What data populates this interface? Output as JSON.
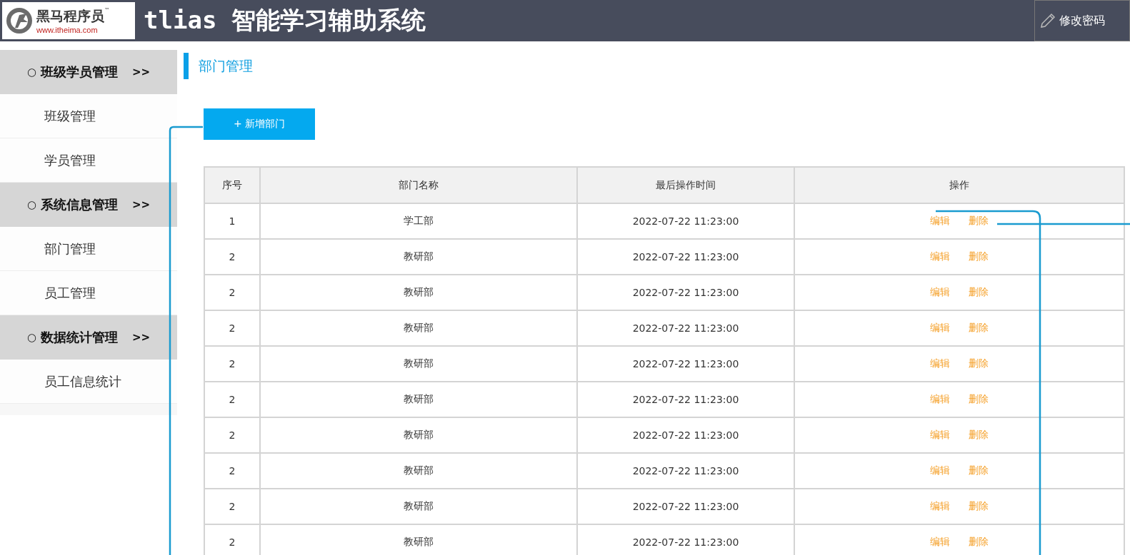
{
  "header": {
    "logo": {
      "brand": "黑马程序员",
      "tm": "™",
      "url": "www.itheima.com"
    },
    "title": "tlias 智能学习辅助系统",
    "action": "修改密码"
  },
  "sidebar": {
    "groups": [
      {
        "marker": "○",
        "label": "班级学员管理",
        "arrow": ">>",
        "children": [
          {
            "label": "班级管理"
          },
          {
            "label": "学员管理"
          }
        ]
      },
      {
        "marker": "○",
        "label": "系统信息管理",
        "arrow": ">>",
        "children": [
          {
            "label": "部门管理"
          },
          {
            "label": "员工管理"
          }
        ]
      },
      {
        "marker": "○",
        "label": "数据统计管理",
        "arrow": ">>",
        "children": [
          {
            "label": "员工信息统计"
          }
        ]
      }
    ]
  },
  "page_title": "部门管理",
  "add_button": "+ 新增部门",
  "table": {
    "columns": [
      "序号",
      "部门名称",
      "最后操作时间",
      "操作"
    ],
    "rows": [
      {
        "no": "1",
        "name": "学工部",
        "time": "2022-07-22 11:23:00",
        "actions": [
          "编辑",
          "删除"
        ]
      },
      {
        "no": "2",
        "name": "教研部",
        "time": "2022-07-22 11:23:00",
        "actions": [
          "编辑",
          "删除"
        ]
      },
      {
        "no": "2",
        "name": "教研部",
        "time": "2022-07-22 11:23:00",
        "actions": [
          "编辑",
          "删除"
        ]
      },
      {
        "no": "2",
        "name": "教研部",
        "time": "2022-07-22 11:23:00",
        "actions": [
          "编辑",
          "删除"
        ]
      },
      {
        "no": "2",
        "name": "教研部",
        "time": "2022-07-22 11:23:00",
        "actions": [
          "编辑",
          "删除"
        ]
      },
      {
        "no": "2",
        "name": "教研部",
        "time": "2022-07-22 11:23:00",
        "actions": [
          "编辑",
          "删除"
        ]
      },
      {
        "no": "2",
        "name": "教研部",
        "time": "2022-07-22 11:23:00",
        "actions": [
          "编辑",
          "删除"
        ]
      },
      {
        "no": "2",
        "name": "教研部",
        "time": "2022-07-22 11:23:00",
        "actions": [
          "编辑",
          "删除"
        ]
      },
      {
        "no": "2",
        "name": "教研部",
        "time": "2022-07-22 11:23:00",
        "actions": [
          "编辑",
          "删除"
        ]
      },
      {
        "no": "2",
        "name": "教研部",
        "time": "2022-07-22 11:23:00",
        "actions": [
          "编辑",
          "删除"
        ]
      }
    ]
  }
}
